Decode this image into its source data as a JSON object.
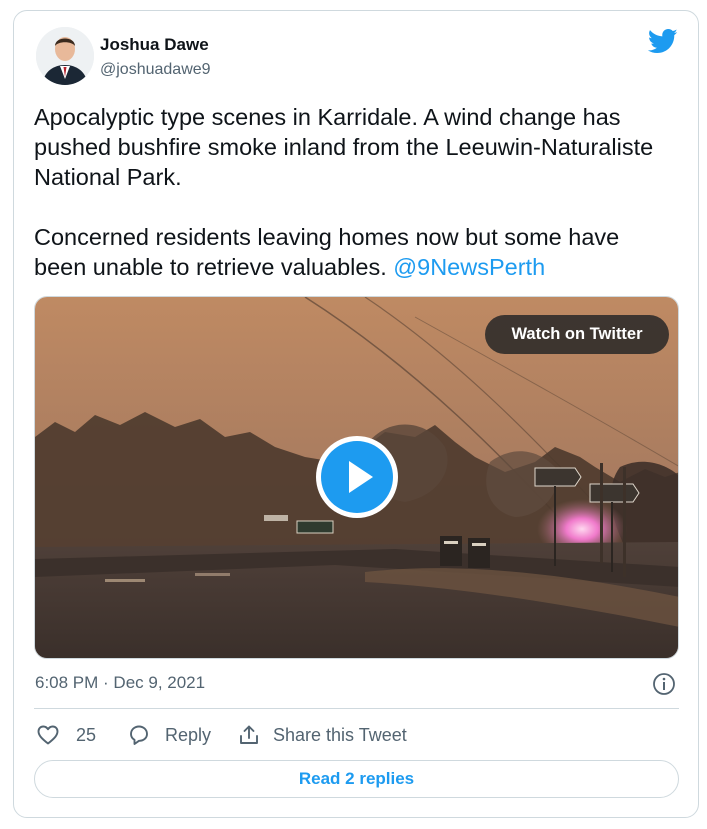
{
  "author": {
    "name": "Joshua Dawe",
    "handle": "@joshuadawe9"
  },
  "tweet": {
    "paragraph1": "Apocalyptic type scenes in Karridale. A wind change has pushed bushfire smoke inland from the Leeuwin-Naturaliste National Park.",
    "paragraph2": "Concerned residents leaving homes now but some have been unable to retrieve valuables. ",
    "mention": "@9NewsPerth",
    "timestamp": "6:08 PM · Dec 9, 2021"
  },
  "media": {
    "watch_label": "Watch on Twitter"
  },
  "actions": {
    "like_count": "25",
    "reply_label": "Reply",
    "share_label": "Share this Tweet"
  },
  "footer": {
    "read_replies_label": "Read 2 replies"
  },
  "colors": {
    "accent": "#1d9bf0",
    "text": "#0f1419",
    "secondary": "#536471",
    "border": "#cfd9de"
  },
  "icons": [
    "twitter-bird-icon",
    "play-icon",
    "info-icon",
    "heart-icon",
    "reply-icon",
    "share-icon"
  ]
}
